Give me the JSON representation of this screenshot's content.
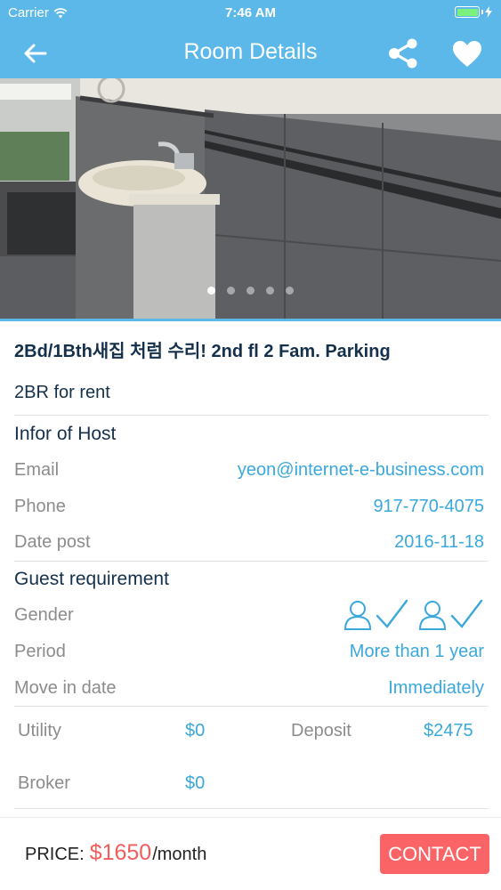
{
  "status_bar": {
    "carrier": "Carrier",
    "time": "7:46 AM"
  },
  "header": {
    "title": "Room Details",
    "back_icon": "back-arrow-icon",
    "share_icon": "share-icon",
    "favorite_icon": "heart-icon"
  },
  "gallery": {
    "image_count": 5,
    "active_index": 0
  },
  "listing": {
    "title": "2Bd/1Bth새집 처럼 수리! 2nd fl 2 Fam. Parking",
    "subtitle": "2BR for rent"
  },
  "host": {
    "section_label": "Infor of Host",
    "email_label": "Email",
    "email": "yeon@internet-e-business.com",
    "phone_label": "Phone",
    "phone": "917-770-4075",
    "date_label": "Date post",
    "date": "2016-11-18"
  },
  "requirements": {
    "section_label": "Guest requirement",
    "gender_label": "Gender",
    "gender_icons": [
      "user-check-icon",
      "user-check-icon"
    ],
    "period_label": "Period",
    "period": "More than 1 year",
    "move_in_label": "Move in date",
    "move_in": "Immediately"
  },
  "costs": {
    "utility_label": "Utility",
    "utility": "$0",
    "deposit_label": "Deposit",
    "deposit": "$2475",
    "broker_label": "Broker",
    "broker": "$0"
  },
  "footer": {
    "price_label": "PRICE:",
    "price": "$1650",
    "price_unit": "/month",
    "contact_label": "CONTACT"
  },
  "colors": {
    "accent": "#5bb8e8",
    "link": "#3aa8dc",
    "price": "#f25c5c",
    "contact_bg": "#fa6466",
    "heading": "#15304b"
  }
}
